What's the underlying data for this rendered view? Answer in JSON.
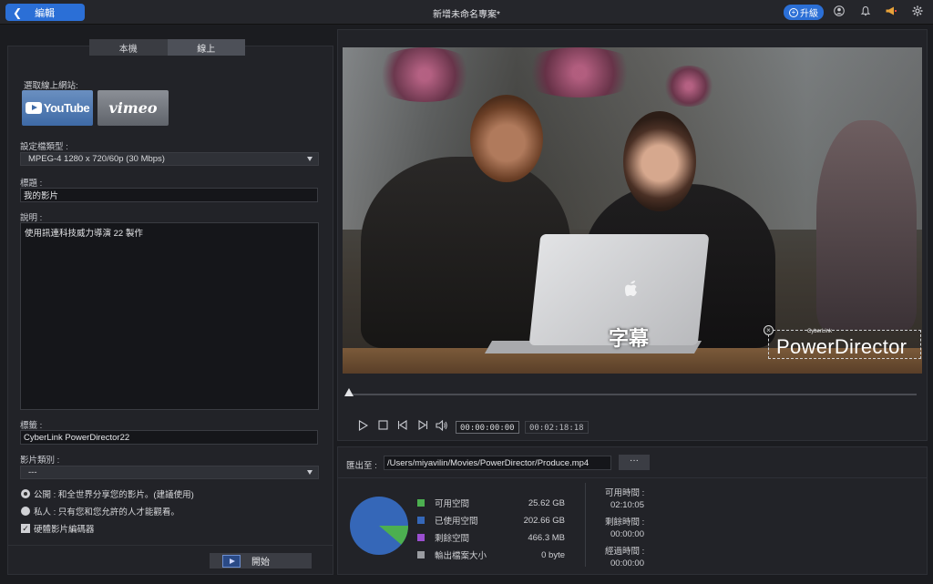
{
  "titlebar": {
    "back_label": "編輯",
    "title": "新增未命名專案*",
    "upgrade_label": "升級"
  },
  "tabs": [
    {
      "label": "本機",
      "active": false
    },
    {
      "label": "線上",
      "active": true
    }
  ],
  "online": {
    "site_label": "選取線上網站:",
    "youtube_label": "YouTube",
    "vimeo_label": "vimeo"
  },
  "form": {
    "format_label": "設定檔類型 :",
    "format_value": "MPEG-4 1280 x 720/60p (30 Mbps)",
    "title_label": "標題 :",
    "title_value": "我的影片",
    "desc_label": "說明 :",
    "desc_value": "使用訊連科技威力導演 22 製作",
    "tags_label": "標籤 :",
    "tags_value": "CyberLink PowerDirector22",
    "category_label": "影片類別 :",
    "category_value": "---",
    "public_label": "公開 : 和全世界分享您的影片。(建議使用)",
    "private_label": "私人 : 只有您和您允許的人才能觀看。",
    "hw_encoder_label": "硬體影片編碼器",
    "start_label": "開始"
  },
  "preview": {
    "subtitle": "字幕",
    "watermark_small": "CyberLink",
    "watermark": "PowerDirector",
    "current_time": "00:00:00:00",
    "duration": "00:02:18:18"
  },
  "output": {
    "label": "匯出至 :",
    "path": "/Users/miyavilin/Movies/PowerDirector/Produce.mp4",
    "browse_label": "···",
    "legend": [
      {
        "label": "可用空間",
        "value": "25.62 GB",
        "color": "#4caf50"
      },
      {
        "label": "已使用空間",
        "value": "202.66 GB",
        "color": "#3567b8"
      },
      {
        "label": "剩餘空間",
        "value": "466.3 MB",
        "color": "#9b4fd0"
      },
      {
        "label": "輸出檔案大小",
        "value": "0 byte",
        "color": "#9a9ca1"
      }
    ],
    "available_time_label": "可用時間 :",
    "available_time": "02:10:05",
    "remaining_time_label": "剩餘時間 :",
    "remaining_time": "00:00:00",
    "elapsed_time_label": "經過時間 :",
    "elapsed_time": "00:00:00"
  },
  "colors": {
    "accent": "#2b6fd6",
    "pie_free": "#4caf50",
    "pie_used": "#3567b8"
  },
  "disk_usage": {
    "free_gb": 25.62,
    "used_gb": 202.66
  }
}
